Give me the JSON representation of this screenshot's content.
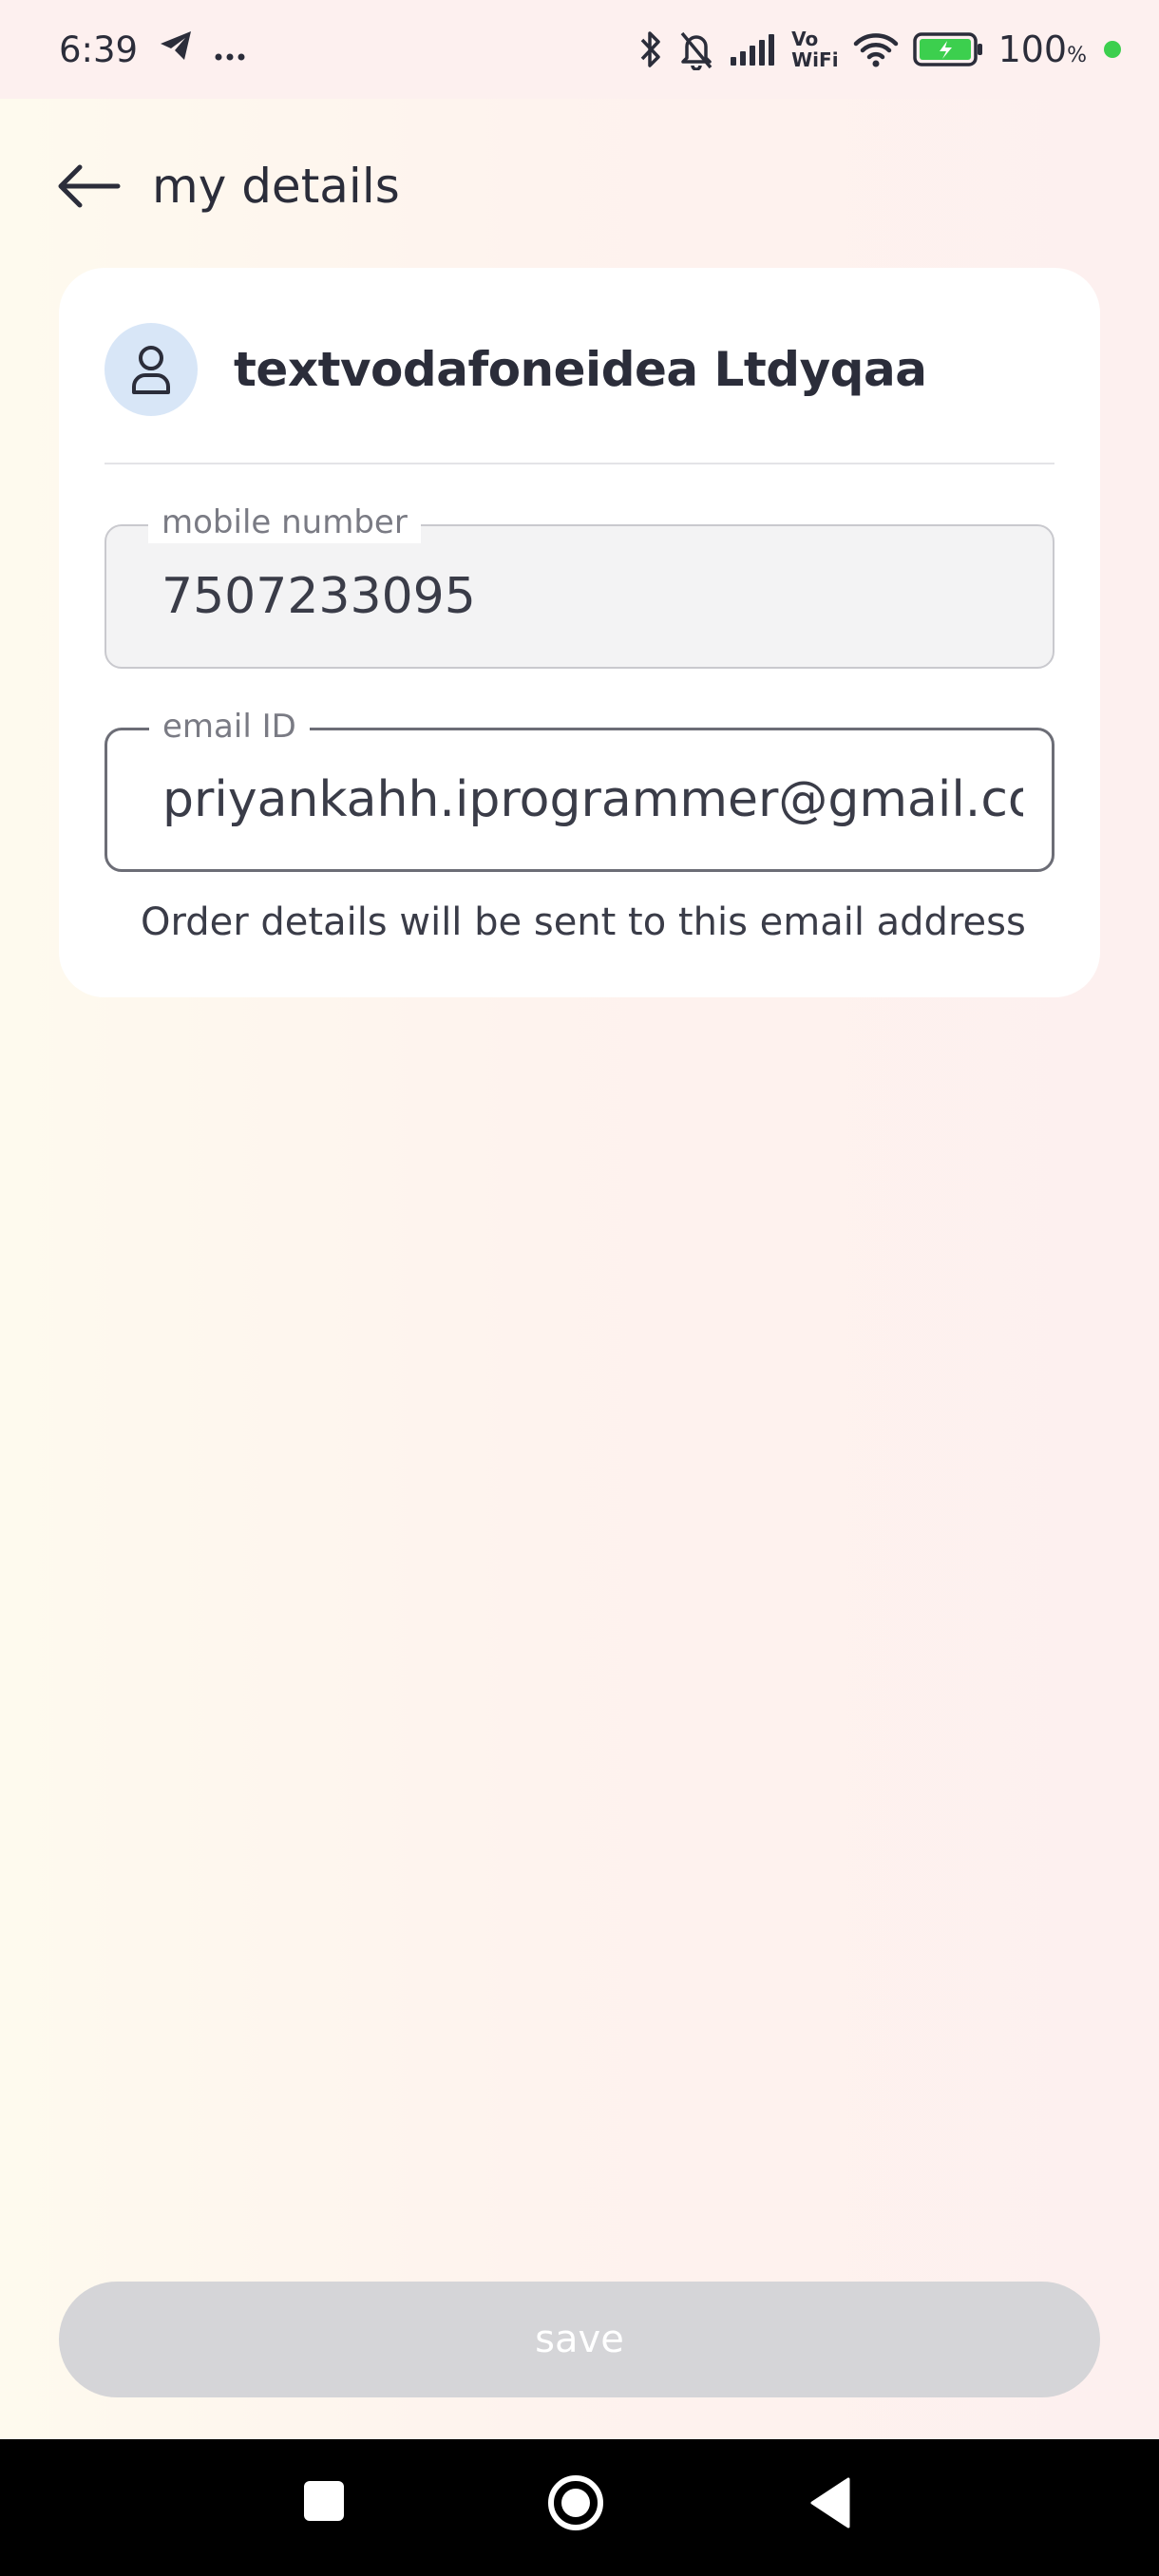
{
  "status_bar": {
    "time": "6:39",
    "icons": [
      "telegram-icon",
      "more-icon",
      "bluetooth-icon",
      "bell-off-icon",
      "signal-icon",
      "vowifi-icon",
      "wifi-icon",
      "battery-icon"
    ],
    "vowifi_top": "Vo",
    "vowifi_bottom": "WiFi",
    "battery_percent": "100",
    "battery_unit": "%"
  },
  "header": {
    "title": "my details",
    "back_icon": "arrow-left-icon"
  },
  "profile": {
    "name": "textvodafoneidea Ltdyqaa",
    "avatar_icon": "user-icon"
  },
  "form": {
    "mobile": {
      "label": "mobile number",
      "value": "7507233095"
    },
    "email": {
      "label": "email ID",
      "value": "priyankahh.iprogrammer@gmail.com"
    },
    "helper": "Order details will be sent to this email address"
  },
  "actions": {
    "save_label": "save"
  },
  "colors": {
    "accent_avatar": "#d8e6f7",
    "button_disabled": "#d5d5d8",
    "text_primary": "#2b2d3a"
  }
}
